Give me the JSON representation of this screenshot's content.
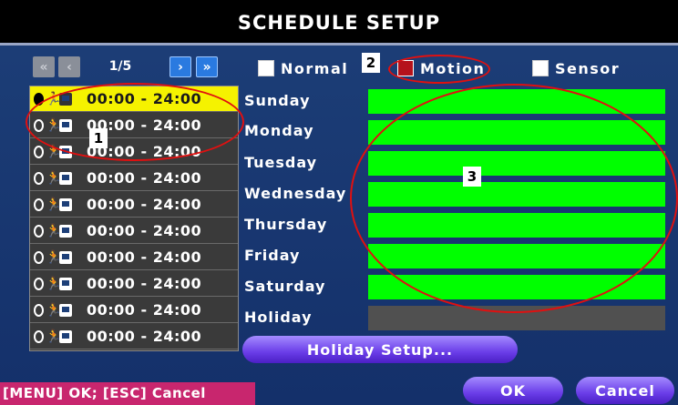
{
  "title": "SCHEDULE SETUP",
  "nav": {
    "first_icon": "double-left-arrow",
    "prev_icon": "left-arrow",
    "page": "1/5",
    "next_icon": "right-arrow",
    "last_icon": "double-right-arrow"
  },
  "slots": [
    {
      "time": "00:00 - 24:00",
      "selected": true
    },
    {
      "time": "00:00 - 24:00"
    },
    {
      "time": "00:00 - 24:00"
    },
    {
      "time": "00:00 - 24:00"
    },
    {
      "time": "00:00 - 24:00"
    },
    {
      "time": "00:00 - 24:00"
    },
    {
      "time": "00:00 - 24:00"
    },
    {
      "time": "00:00 - 24:00"
    },
    {
      "time": "00:00 - 24:00"
    },
    {
      "time": "00:00 - 24:00"
    }
  ],
  "triggers": [
    {
      "label": "Normal",
      "checked": false
    },
    {
      "label": "Motion",
      "checked": true
    },
    {
      "label": "Sensor",
      "checked": false
    }
  ],
  "days": [
    {
      "label": "Sunday",
      "scheduled": true
    },
    {
      "label": "Monday",
      "scheduled": true
    },
    {
      "label": "Tuesday",
      "scheduled": true
    },
    {
      "label": "Wednesday",
      "scheduled": true
    },
    {
      "label": "Thursday",
      "scheduled": true
    },
    {
      "label": "Friday",
      "scheduled": true
    },
    {
      "label": "Saturday",
      "scheduled": true
    },
    {
      "label": "Holiday",
      "scheduled": false
    }
  ],
  "buttons": {
    "holiday_setup": "Holiday Setup...",
    "ok": "OK",
    "cancel": "Cancel"
  },
  "hint": "[MENU] OK; [ESC] Cancel",
  "annotations": [
    "1",
    "2",
    "3"
  ],
  "colors": {
    "scheduled": "#00ff00",
    "unscheduled": "#505050",
    "selected_slot": "#f5f200",
    "annotation": "#e01010"
  }
}
